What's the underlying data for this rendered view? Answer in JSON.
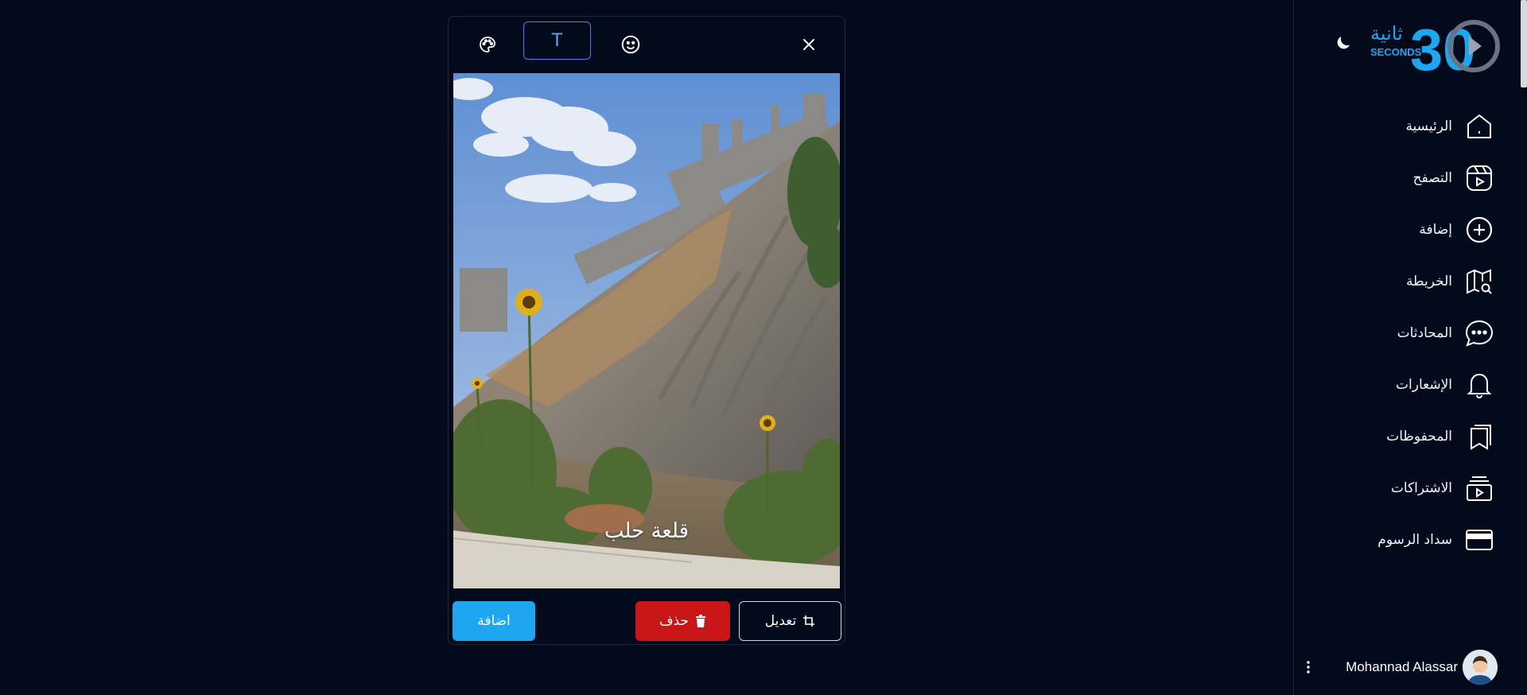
{
  "brand": {
    "arabic_word": "ثانية",
    "english_word": "SECONDS",
    "number": "30",
    "colors": {
      "primary": "#1ea7f0",
      "ring": "#6b7280"
    }
  },
  "sidebar": {
    "items": [
      {
        "label": "الرئيسية",
        "icon": "home-icon"
      },
      {
        "label": "التصفح",
        "icon": "reels-icon"
      },
      {
        "label": "إضافة",
        "icon": "add-circle-icon"
      },
      {
        "label": "الخريطة",
        "icon": "map-search-icon"
      },
      {
        "label": "المحادثات",
        "icon": "chat-icon"
      },
      {
        "label": "الإشعارات",
        "icon": "bell-icon"
      },
      {
        "label": "المحفوظات",
        "icon": "bookmark-icon"
      },
      {
        "label": "الاشتراكات",
        "icon": "subscriptions-icon"
      },
      {
        "label": "سداد الرسوم",
        "icon": "credit-card-icon"
      }
    ],
    "theme_icon": "moon-icon"
  },
  "user": {
    "name": "Mohannad Alassar",
    "menu_icon": "more-vertical-icon"
  },
  "editor": {
    "tools": {
      "palette_icon": "palette-icon",
      "text_tool_label": "T",
      "emoji_icon": "smiley-icon",
      "close_icon": "close-icon"
    },
    "overlay_text": "قلعة حلب",
    "buttons": {
      "add": "اضافة",
      "delete": "حذف",
      "edit": "تعديل"
    },
    "colors": {
      "add": "#1ea7f0",
      "delete": "#c81517",
      "selected_tool": "#3b82f6"
    }
  }
}
